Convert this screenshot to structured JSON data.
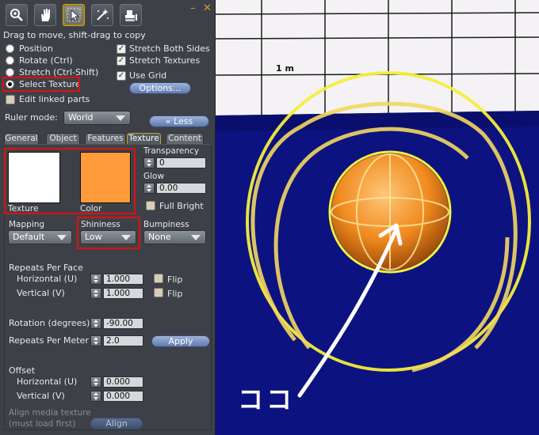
{
  "toolbar": {
    "tools": [
      {
        "name": "focus-tool",
        "icon": "magnifier-icon"
      },
      {
        "name": "grab-tool",
        "icon": "hand-icon"
      },
      {
        "name": "build-tool",
        "icon": "cursor-icon"
      },
      {
        "name": "create-tool",
        "icon": "wand-icon"
      },
      {
        "name": "land-tool",
        "icon": "bulldozer-icon"
      }
    ],
    "minimize": "–",
    "close": "✕"
  },
  "edit": {
    "hint": "Drag to move, shift-drag to copy",
    "modes": [
      {
        "label": "Position",
        "selected": false
      },
      {
        "label": "Rotate (Ctrl)",
        "selected": false
      },
      {
        "label": "Stretch (Ctrl-Shift)",
        "selected": false
      },
      {
        "label": "Select Texture",
        "selected": true
      }
    ],
    "options": [
      {
        "label": "Stretch Both Sides",
        "checked": true
      },
      {
        "label": "Stretch Textures",
        "checked": true
      },
      {
        "label": "Use Grid",
        "checked": true
      }
    ],
    "options_button": "Options...",
    "edit_linked": "Edit linked parts",
    "edit_linked_checked": false,
    "ruler_label": "Ruler mode:",
    "ruler_value": "World",
    "less_button": "« Less"
  },
  "tabs": [
    {
      "label": "General",
      "active": false
    },
    {
      "label": "Object",
      "active": false
    },
    {
      "label": "Features",
      "active": false
    },
    {
      "label": "Texture",
      "active": true
    },
    {
      "label": "Content",
      "active": false
    }
  ],
  "texture": {
    "texture_label": "Texture",
    "color_label": "Color",
    "texture_color": "#ffffff",
    "color_value": "#ff9b3a",
    "transparency_label": "Transparency",
    "transparency_value": "0",
    "glow_label": "Glow",
    "glow_value": "0.00",
    "full_bright": "Full Bright",
    "mapping_label": "Mapping",
    "mapping_value": "Default",
    "shininess_label": "Shininess",
    "shininess_value": "Low",
    "bumpiness_label": "Bumpiness",
    "bumpiness_value": "None",
    "repeats_label": "Repeats Per Face",
    "horizontal_label": "Horizontal (U)",
    "horizontal_value": "1.000",
    "vertical_label": "Vertical (V)",
    "vertical_value": "1.000",
    "flip_label": "Flip",
    "rotation_label": "Rotation (degrees)",
    "rotation_value": "-90.00",
    "repeats_meter_label": "Repeats Per Meter",
    "repeats_meter_value": "2.0",
    "apply_button": "Apply",
    "offset_label": "Offset",
    "offset_h_label": "Horizontal (U)",
    "offset_h_value": "0.000",
    "offset_v_label": "Vertical (V)",
    "offset_v_value": "0.000",
    "align_label_1": "Align media texture",
    "align_label_2": "(must load first)",
    "align_button": "Align"
  },
  "viewport": {
    "ruler_text": "1 m",
    "annotation": "ココ"
  },
  "colors": {
    "highlight_red": "#e01010",
    "selection_yellow": "#f4ee3a",
    "ground_blue": "#0c1280"
  }
}
